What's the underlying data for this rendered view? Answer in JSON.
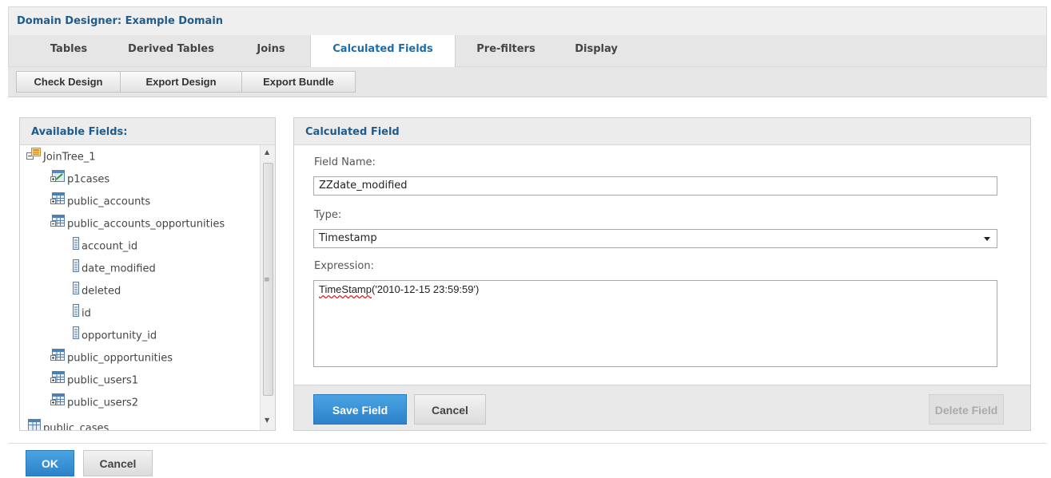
{
  "window": {
    "title": "Domain Designer: Example Domain"
  },
  "tabs": [
    "Tables",
    "Derived Tables",
    "Joins",
    "Calculated Fields",
    "Pre-filters",
    "Display"
  ],
  "active_tab": "Calculated Fields",
  "toolbar": {
    "check_design": "Check Design",
    "export_design": "Export Design",
    "export_bundle": "Export Bundle"
  },
  "available_fields": {
    "title": "Available Fields:",
    "tree": [
      {
        "label": "JoinTree_1",
        "icon": "join-tree-icon",
        "level": 0
      },
      {
        "label": "p1cases",
        "icon": "derived-table-icon",
        "level": 1
      },
      {
        "label": "public_accounts",
        "icon": "table-icon",
        "level": 1
      },
      {
        "label": "public_accounts_opportunities",
        "icon": "table-icon",
        "level": 1
      },
      {
        "label": "account_id",
        "icon": "field-icon",
        "level": 2
      },
      {
        "label": "date_modified",
        "icon": "field-icon",
        "level": 2
      },
      {
        "label": "deleted",
        "icon": "field-icon",
        "level": 2
      },
      {
        "label": "id",
        "icon": "field-icon",
        "level": 2
      },
      {
        "label": "opportunity_id",
        "icon": "field-icon",
        "level": 2
      },
      {
        "label": "public_opportunities",
        "icon": "table-icon",
        "level": 1
      },
      {
        "label": "public_users1",
        "icon": "table-icon",
        "level": 1
      },
      {
        "label": "public_users2",
        "icon": "table-icon",
        "level": 1
      },
      {
        "label": "public_cases",
        "icon": "table-icon",
        "level": 0
      }
    ]
  },
  "calculated_field": {
    "title": "Calculated Field",
    "field_name_label": "Field Name:",
    "field_name_value": "ZZdate_modified",
    "type_label": "Type:",
    "type_value": "Timestamp",
    "expression_label": "Expression:",
    "expression_func": "TimeStamp",
    "expression_rest": "('2010-12-15 23:59:59')",
    "save_label": "Save Field",
    "cancel_label": "Cancel",
    "delete_label": "Delete Field"
  },
  "footer": {
    "ok_label": "OK",
    "cancel_label": "Cancel"
  },
  "colors": {
    "accent": "#1f6da8",
    "primary_button": "#2d82c9",
    "heading": "#1f5c8c"
  }
}
